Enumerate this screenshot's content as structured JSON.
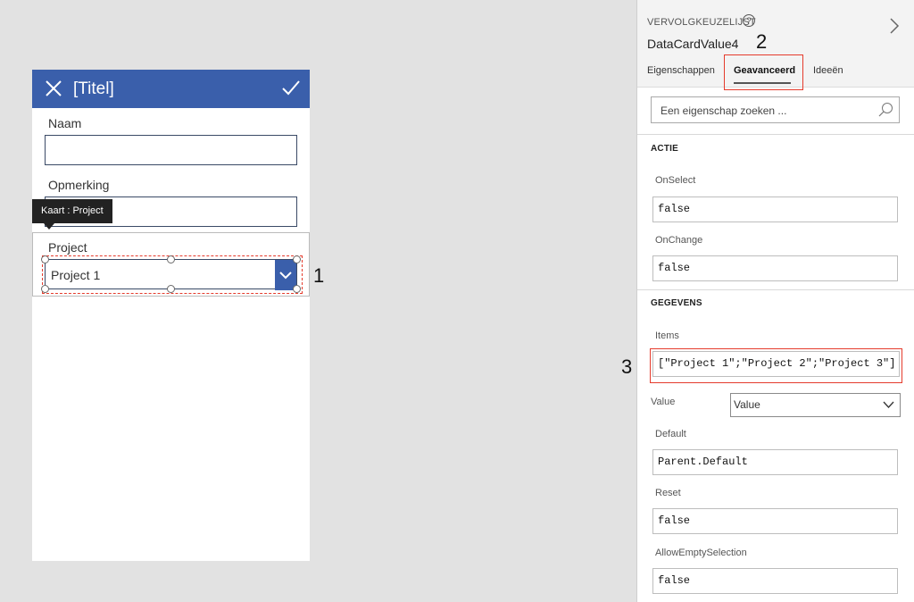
{
  "form": {
    "title": "[Titel]",
    "icons": {
      "close": "close-icon",
      "check": "checkmark-icon"
    },
    "fields": [
      {
        "label": "Naam",
        "value": ""
      },
      {
        "label": "Opmerking",
        "value": ""
      }
    ],
    "tooltip": "Kaart : Project",
    "project_card": {
      "label": "Project",
      "selected": "Project 1"
    }
  },
  "callouts": {
    "one": "1",
    "two": "2",
    "three": "3"
  },
  "panel": {
    "control_type": "VERVOLGKEUZELIJST",
    "control_name": "DataCardValue4",
    "tabs": [
      "Eigenschappen",
      "Geavanceerd",
      "Ideeën"
    ],
    "active_tab": "Geavanceerd",
    "search_placeholder": "Een eigenschap zoeken ...",
    "sections": {
      "actie": {
        "title": "ACTIE",
        "props": [
          {
            "label": "OnSelect",
            "value": "false"
          },
          {
            "label": "OnChange",
            "value": "false"
          }
        ]
      },
      "gegevens": {
        "title": "GEGEVENS",
        "items": {
          "label": "Items",
          "value": "[\"Project 1\";\"Project 2\";\"Project 3\"]"
        },
        "value_prop": {
          "label": "Value",
          "selected": "Value"
        },
        "props": [
          {
            "label": "Default",
            "value": "Parent.Default"
          },
          {
            "label": "Reset",
            "value": "false"
          },
          {
            "label": "AllowEmptySelection",
            "value": "false"
          }
        ]
      }
    }
  },
  "colors": {
    "accent": "#3a5fab",
    "highlight": "#e53b2c",
    "canvas": "#e2e2e2"
  }
}
